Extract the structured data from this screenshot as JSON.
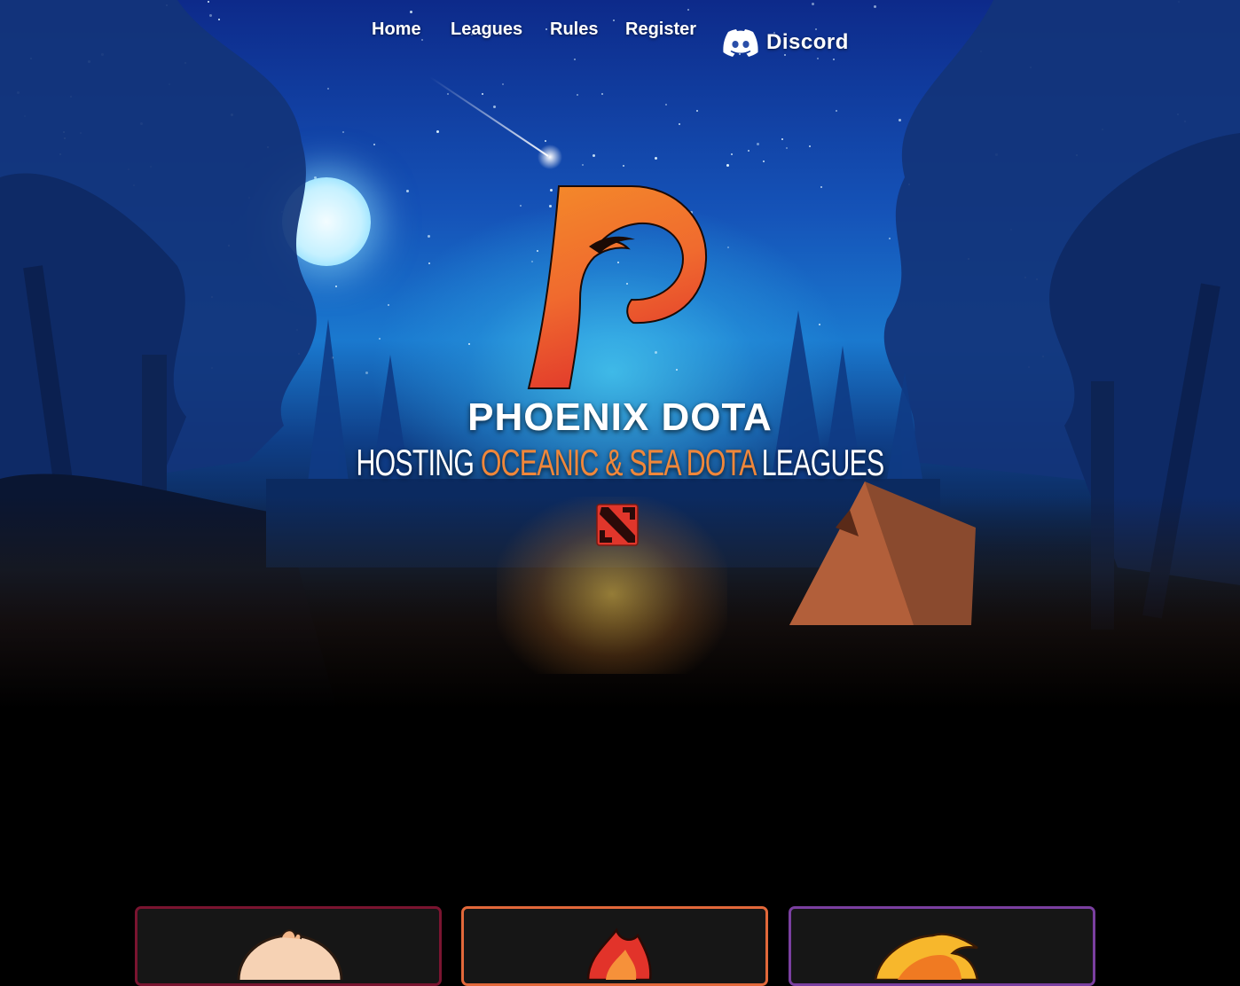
{
  "nav": {
    "items": [
      "Home",
      "Leagues",
      "Rules",
      "Register"
    ],
    "discord_label": "Discord",
    "discord_icon": "discord-icon"
  },
  "hero": {
    "title": "PHOENIX DOTA",
    "subtitle_pre": "HOSTING ",
    "subtitle_highlight": "OCEANIC & SEA DOTA",
    "subtitle_post": " LEAGUES",
    "logo_icon": "phoenix-p-logo",
    "game_icon": "dota-icon"
  },
  "colors": {
    "accent_orange": "#f0873a",
    "card_border_1": "#7a1430",
    "card_border_2": "#e2683a",
    "card_border_3": "#7a3fa0"
  },
  "cards": [
    {
      "icon": "baby-avatar-icon",
      "border": "#7a1430"
    },
    {
      "icon": "flame-avatar-icon",
      "border": "#e2683a"
    },
    {
      "icon": "phoenix-avatar-icon",
      "border": "#7a3fa0"
    }
  ]
}
